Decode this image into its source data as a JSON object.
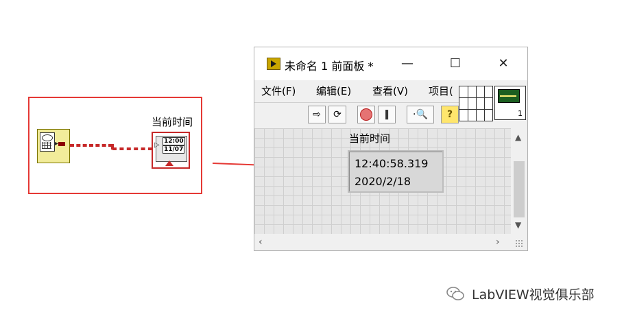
{
  "block_diagram": {
    "indicator_label": "当前时间",
    "terminal_time": "12:00",
    "terminal_date": "11/07",
    "node_icon": "get-date-time-icon"
  },
  "window": {
    "title": "未命名 1 前面板 *",
    "controls": {
      "minimize": "—",
      "maximize": "☐",
      "close": "✕"
    },
    "menu": [
      "文件(F)",
      "编辑(E)",
      "查看(V)",
      "项目("
    ],
    "toolbar_icons": [
      "run-arrow-icon",
      "run-continuous-icon",
      "abort-icon",
      "pause-icon",
      "highlight-icon",
      "context-help-icon"
    ],
    "vi_icon_number": "1"
  },
  "front_panel": {
    "indicator_label": "当前时间",
    "time_value": "12:40:58.319",
    "date_value": "2020/2/18"
  },
  "watermark": "LabVIEW视觉俱乐部",
  "colors": {
    "highlight_border": "#e53935",
    "wire": "#c62828",
    "arrow": "#e53935"
  }
}
